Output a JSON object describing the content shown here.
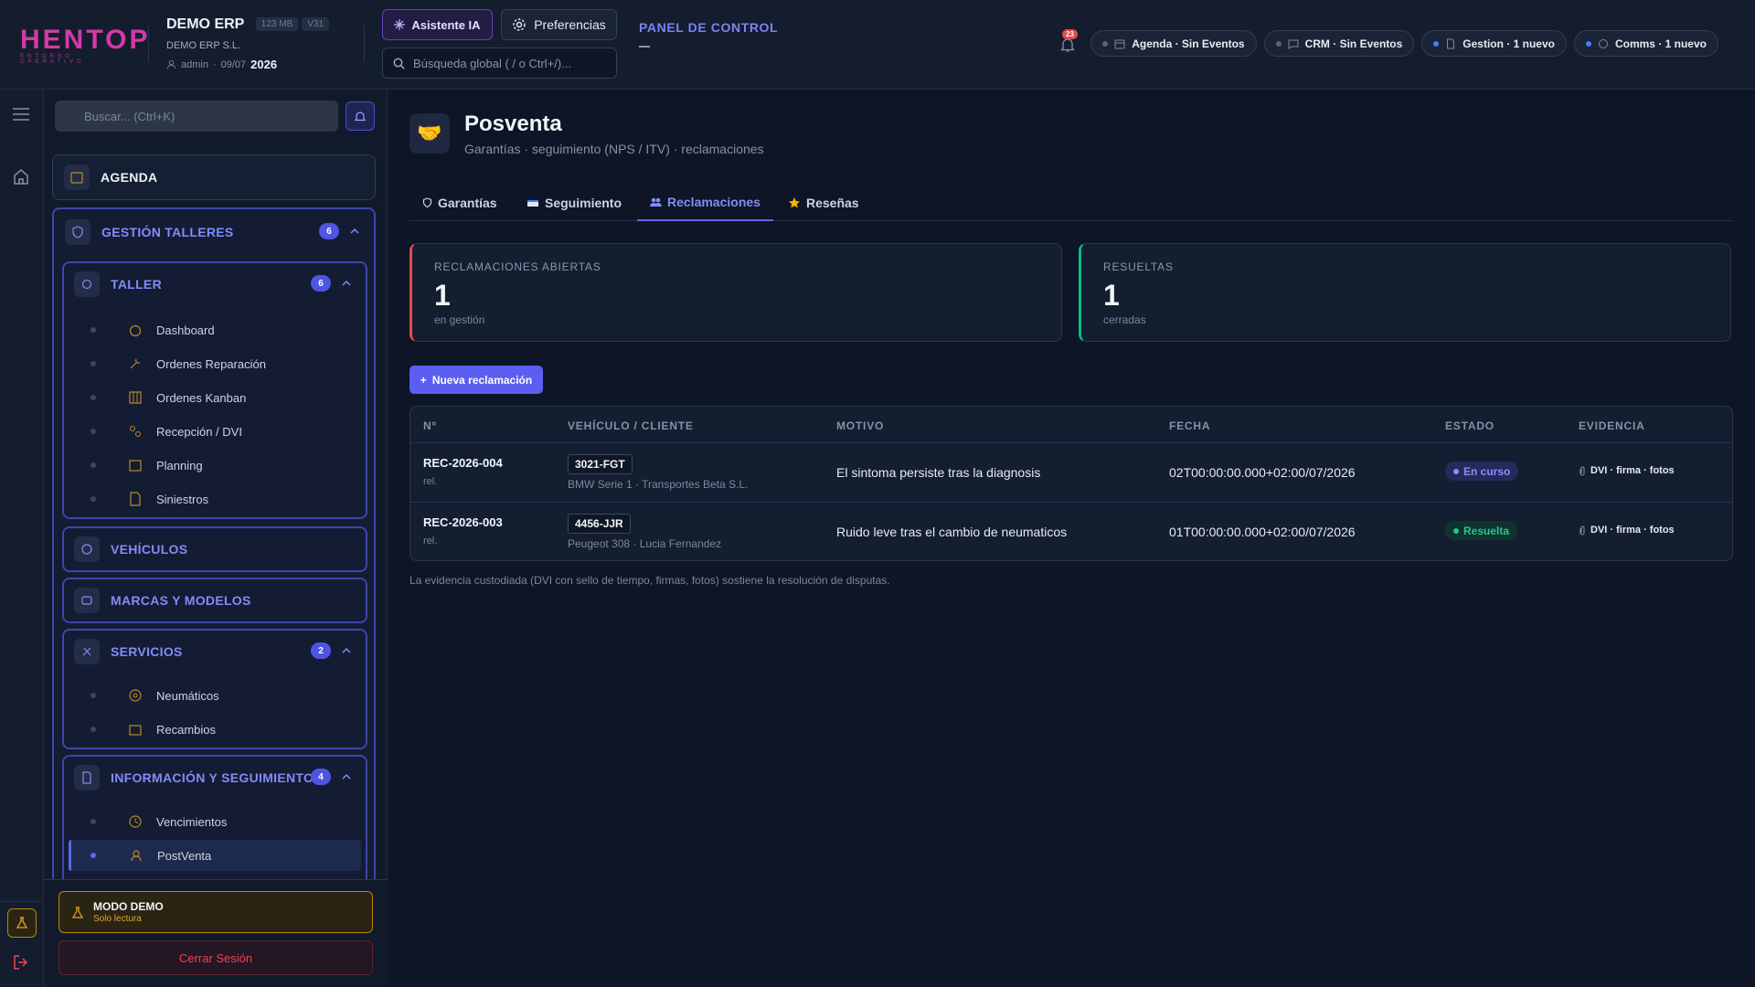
{
  "brand": {
    "logo_text": "HENTOP",
    "logo_sub": "ENTORNO OPERATIVO"
  },
  "org": {
    "name": "DEMO ERP",
    "size": "123 MB",
    "version": "V31",
    "company": "DEMO ERP S.L.",
    "user": "admin",
    "date": "09/07",
    "year": "2026"
  },
  "header": {
    "ai_label": "Asistente IA",
    "prefs_label": "Preferencias",
    "search_placeholder": "Búsqueda global ( / o Ctrl+/)...",
    "panel_title": "PANEL DE CONTROL",
    "notif_count": "23",
    "chips": [
      {
        "label": "Agenda · Sin Eventos",
        "dot": "#5b6479"
      },
      {
        "label": "CRM · Sin Eventos",
        "dot": "#5b6479"
      },
      {
        "label": "Gestion · 1 nuevo",
        "dot": "#3b82f6"
      },
      {
        "label": "Comms · 1 nuevo",
        "dot": "#3b82f6"
      }
    ]
  },
  "sidebar": {
    "search_placeholder": "Buscar... (Ctrl+K)",
    "agenda": "AGENDA",
    "gestion": {
      "label": "GESTIÓN TALLERES",
      "count": "6"
    },
    "taller": {
      "label": "TALLER",
      "count": "6",
      "items": [
        "Dashboard",
        "Ordenes Reparación",
        "Ordenes Kanban",
        "Recepción / DVI",
        "Planning",
        "Siniestros"
      ]
    },
    "vehiculos": "VEHÍCULOS",
    "marcas": "MARCAS Y MODELOS",
    "servicios": {
      "label": "SERVICIOS",
      "count": "2",
      "items": [
        "Neumáticos",
        "Recambios"
      ]
    },
    "info": {
      "label": "INFORMACIÓN Y SEGUIMIENTO",
      "count": "4",
      "items": [
        "Vencimientos",
        "PostVenta"
      ]
    },
    "demo_title": "MODO DEMO",
    "demo_sub": "Solo lectura",
    "logout": "Cerrar Sesión"
  },
  "page": {
    "title": "Posventa",
    "subtitle": "Garantías · seguimiento (NPS / ITV) · reclamaciones",
    "tabs": [
      {
        "label": "Garantías",
        "icon": "shield-icon"
      },
      {
        "label": "Seguimiento",
        "icon": "card-icon"
      },
      {
        "label": "Reclamaciones",
        "icon": "people-icon"
      },
      {
        "label": "Reseñas",
        "icon": "star-icon"
      }
    ],
    "stats": [
      {
        "label": "RECLAMACIONES ABIERTAS",
        "value": "1",
        "sub": "en gestión"
      },
      {
        "label": "RESUELTAS",
        "value": "1",
        "sub": "cerradas"
      }
    ],
    "new_button": "Nueva reclamación",
    "columns": [
      "Nº",
      "VEHÍCULO / CLIENTE",
      "MOTIVO",
      "FECHA",
      "ESTADO",
      "EVIDENCIA"
    ],
    "rows": [
      {
        "id": "REC-2026-004",
        "rel": "rel.",
        "plate": "3021-FGT",
        "vehicle": "BMW Serie 1 · Transportes Beta S.L.",
        "motivo": "El sintoma persiste tras la diagnosis",
        "fecha": "02T00:00:00.000+02:00/07/2026",
        "estado": "En curso",
        "evidencia": "DVI · firma · fotos"
      },
      {
        "id": "REC-2026-003",
        "rel": "rel.",
        "plate": "4456-JJR",
        "vehicle": "Peugeot 308 · Lucia Fernandez",
        "motivo": "Ruido leve tras el cambio de neumaticos",
        "fecha": "01T00:00:00.000+02:00/07/2026",
        "estado": "Resuelta",
        "evidencia": "DVI · firma · fotos"
      }
    ],
    "note": "La evidencia custodiada (DVI con sello de tiempo, firmas, fotos) sostiene la resolución de disputas."
  }
}
